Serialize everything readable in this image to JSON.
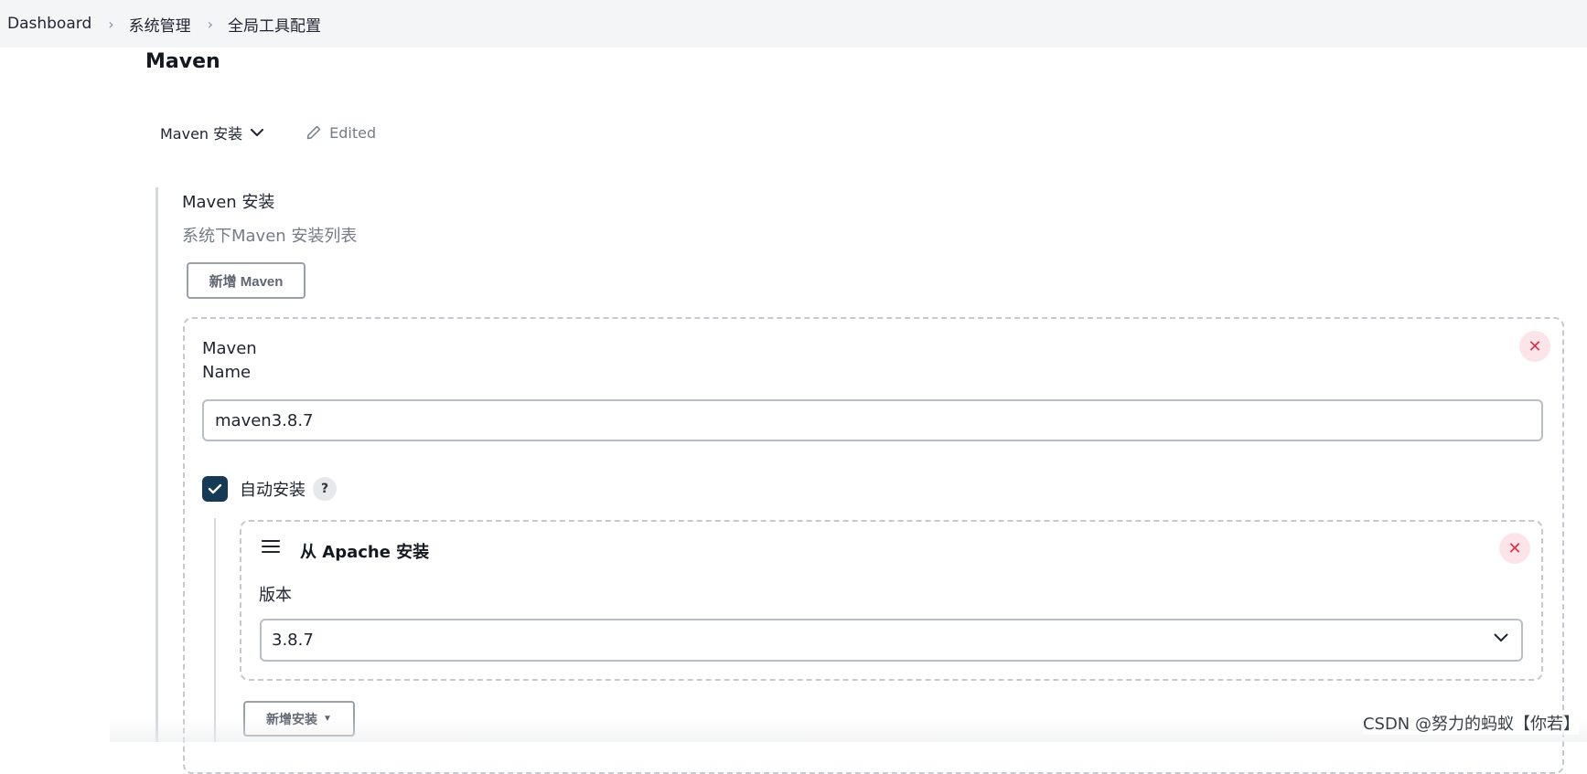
{
  "breadcrumb": {
    "items": [
      "Dashboard",
      "系统管理",
      "全局工具配置"
    ]
  },
  "page": {
    "title": "Maven"
  },
  "tab": {
    "label": "Maven 安装",
    "edited": "Edited"
  },
  "section": {
    "title": "Maven 安装",
    "description": "系统下Maven 安装列表",
    "add_button": "新增 Maven"
  },
  "installation": {
    "label_line1": "Maven",
    "label_line2": "Name",
    "name_value": "maven3.8.7",
    "auto_install_label": "自动安装",
    "auto_install_checked": true,
    "help": "?",
    "installer": {
      "title": "从 Apache 安装",
      "version_label": "版本",
      "version_value": "3.8.7"
    },
    "add_installer_button": "新增安装"
  },
  "watermark": "CSDN @努力的蚂蚁【你若】",
  "colors": {
    "checkbox": "#143a56",
    "close_bg": "#fbe5e8",
    "close_fg": "#d9324a",
    "muted_text": "#757b87"
  }
}
